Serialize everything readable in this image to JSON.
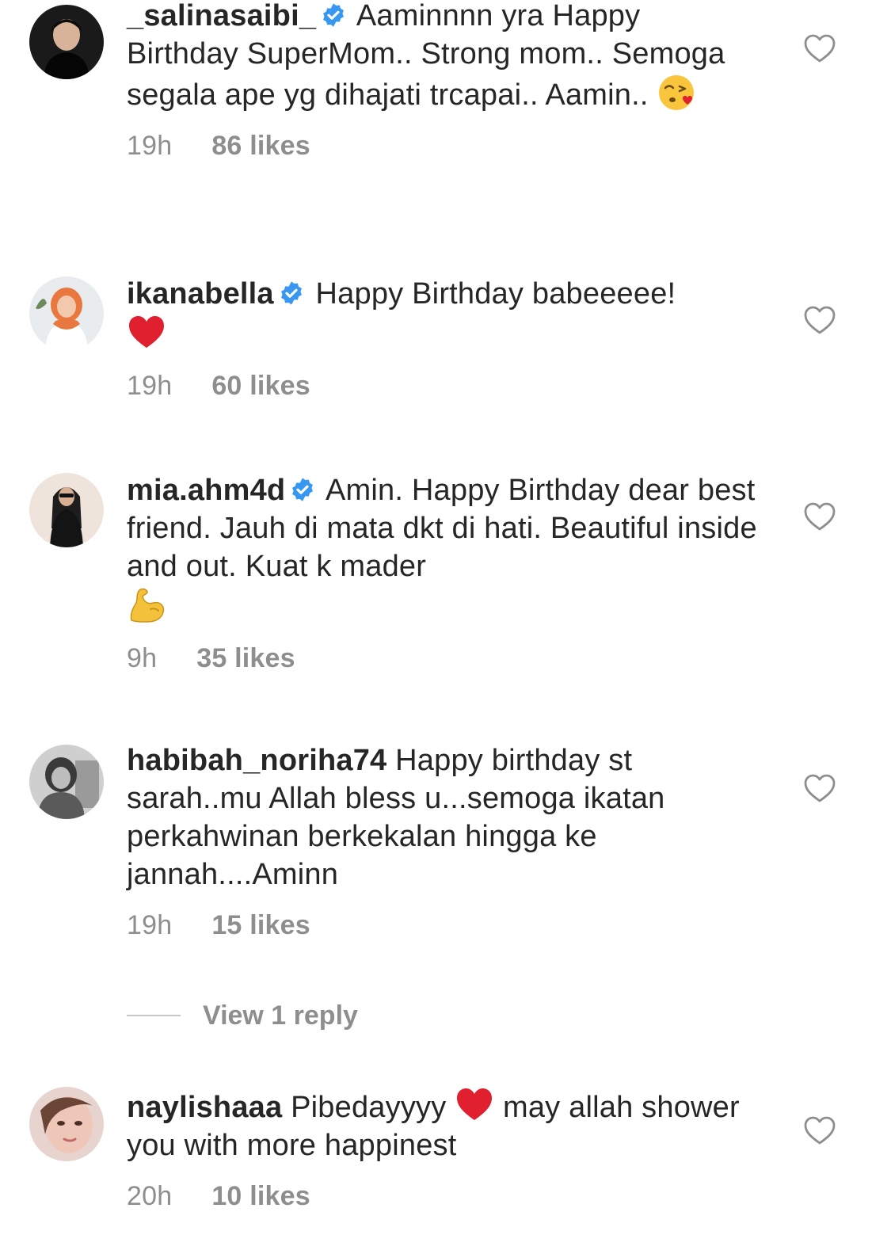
{
  "comments": [
    {
      "username": "_salinasaibi_",
      "verified": true,
      "text": "Aaminnnn yra Happy Birthday SuperMom.. Strong mom.. Semoga segala ape yg dihajati trcapai.. Aamin..",
      "emoji": "face-blowing-kiss",
      "time": "19h",
      "likes": "86 likes"
    },
    {
      "username": "ikanabella",
      "verified": true,
      "text": "Happy Birthday babeeeee!",
      "emoji": "red-heart",
      "time": "19h",
      "likes": "60 likes"
    },
    {
      "username": "mia.ahm4d",
      "verified": true,
      "text": "Amin. Happy Birthday dear best friend. Jauh di mata dkt di hati. Beautiful inside and out. Kuat k mader",
      "emoji": "flexed-biceps",
      "time": "9h",
      "likes": "35 likes"
    },
    {
      "username": "habibah_noriha74",
      "verified": false,
      "text": "Happy birthday st sarah..mu Allah bless u...semoga ikatan perkahwinan berkekalan hingga ke jannah....Aminn",
      "time": "19h",
      "likes": "15 likes",
      "view_replies": "View 1 reply"
    },
    {
      "username": "naylishaaa",
      "verified": false,
      "text_before": "Pibedayyyy",
      "emoji": "red-heart",
      "text_after": "may allah shower you with more happinest",
      "time": "20h",
      "likes": "10 likes"
    }
  ],
  "colors": {
    "text": "#262626",
    "muted": "#8e8e8e",
    "verified_blue": "#3897f0",
    "heart_red": "#e0202f"
  },
  "icons": {
    "like": "heart-outline-icon",
    "verified": "verified-badge-icon"
  }
}
